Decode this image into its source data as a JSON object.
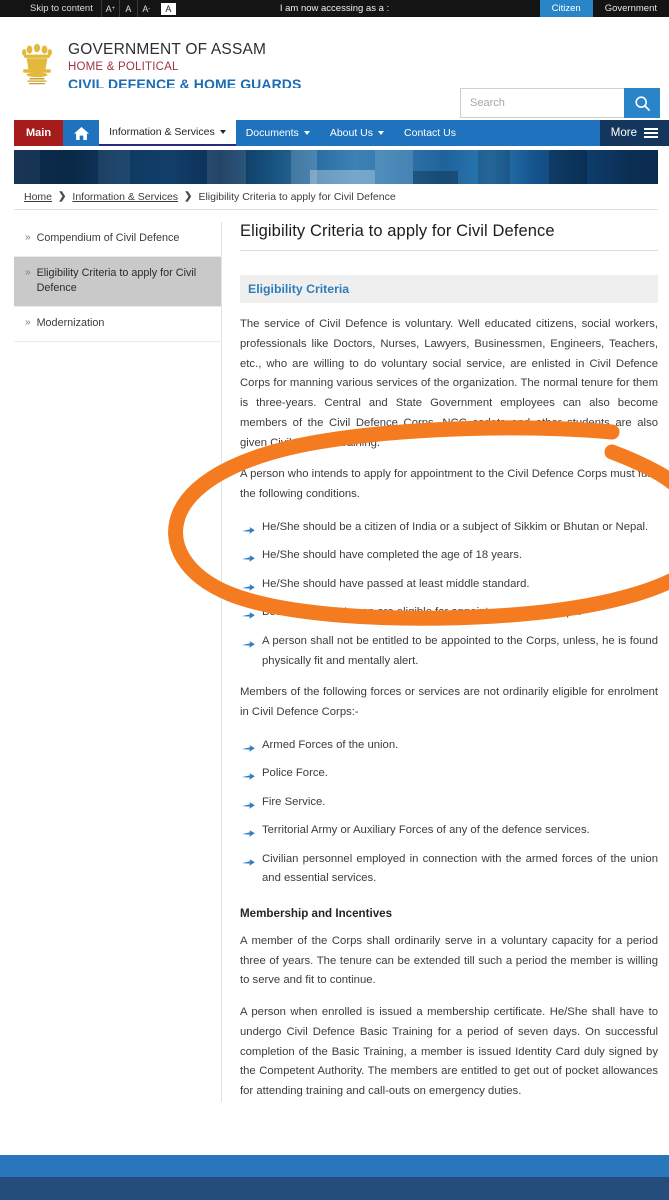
{
  "topbar": {
    "skip_label": "Skip to content",
    "font_increase": "A",
    "font_normal": "A",
    "font_decrease": "A",
    "contrast_toggle": "A",
    "accessing_as_label": "I am now accessing as a :",
    "tabs": [
      {
        "label": "Citizen",
        "active": true
      },
      {
        "label": "Government",
        "active": false
      }
    ]
  },
  "masthead": {
    "emblem_name": "ashoka-emblem",
    "line1": "GOVERNMENT OF ASSAM",
    "line2": "HOME & POLITICAL",
    "line3": "CIVIL DEFENCE & HOME GUARDS"
  },
  "search": {
    "placeholder": "Search",
    "value": "",
    "icon": "search-icon"
  },
  "nav": {
    "main_label": "Main",
    "home_icon": "home-icon",
    "items": [
      {
        "label": "Information & Services",
        "has_caret": true,
        "active": true
      },
      {
        "label": "Documents",
        "has_caret": true,
        "active": false
      },
      {
        "label": "About Us",
        "has_caret": true,
        "active": false
      },
      {
        "label": "Contact Us",
        "has_caret": false,
        "active": false
      }
    ],
    "more_label": "More",
    "more_icon": "hamburger-icon"
  },
  "breadcrumb": {
    "items": [
      {
        "label": "Home",
        "link": true
      },
      {
        "label": "Information & Services",
        "link": true
      },
      {
        "label": "Eligibility Criteria to apply for Civil Defence",
        "link": false
      }
    ],
    "separator": "❯"
  },
  "sidebar": {
    "items": [
      {
        "label": "Compendium of Civil Defence",
        "active": false
      },
      {
        "label": "Eligibility Criteria to apply for Civil Defence",
        "active": true
      },
      {
        "label": "Modernization",
        "active": false
      }
    ],
    "chevron": "»"
  },
  "main": {
    "page_title": "Eligibility Criteria to apply for Civil Defence",
    "sub_heading": "Eligibility Criteria",
    "intro_paragraph": "The service of Civil Defence is voluntary. Well educated citizens, social workers, professionals like Doctors, Nurses, Lawyers, Businessmen, Engineers, Teachers, etc., who are willing to do voluntary social service, are enlisted in Civil Defence Corps for manning various services of the organization. The normal tenure for them is three-years. Central and State Government employees can also become members of the Civil Defence Corps. NCC cadets and other students are also given Civil Defence training.",
    "conditions_lead": " A person who intends to apply for appointment to the Civil Defence Corps must fulfil the following conditions.",
    "conditions": [
      "He/She should be a citizen of India or a subject of Sikkim or Bhutan or Nepal.",
      "He/She should have completed the age of 18 years.",
      "He/She should have passed at least middle standard.",
      "Both Men and Women are eligible for appointment to the Corps.",
      "A person shall not be entitled to be appointed to the Corps, unless, he is found physically fit and mentally alert."
    ],
    "ineligible_lead": "Members of the following forces or services are not ordinarily eligible for enrolment in Civil Defence Corps:-",
    "ineligible": [
      "Armed Forces of the union.",
      "Police Force.",
      "Fire Service.",
      "Territorial Army or Auxiliary Forces of any of the defence services.",
      "Civilian personnel employed in connection with the armed forces of the union and essential services."
    ],
    "membership_heading": "Membership and Incentives",
    "membership_p1": "A member of the Corps shall ordinarily serve in a voluntary capacity for a period three of years. The tenure can be extended till such a period the member is willing to serve and fit to continue.",
    "membership_p2": "A person when enrolled is issued a membership certificate. He/She shall have to undergo Civil Defence Basic Training for a period of seven days. On successful completion of the Basic Training, a member is issued Identity Card duly signed by the Competent Authority. The members are entitled to get out of pocket allowances for attending training and call-outs on emergency duties."
  },
  "annotation": {
    "name": "orange-highlight-ellipse",
    "color": "#F47B20"
  },
  "colors": {
    "topbar_bg": "#141414",
    "accent_blue": "#2a84c8",
    "nav_blue": "#1f72bd",
    "main_red": "#a61c1c",
    "more_navy": "#15365c",
    "brand_maroon": "#9d3440",
    "brand_blue": "#1b6cb5",
    "footer_light": "#2a76bd",
    "footer_dark": "#254d7c",
    "annotation_orange": "#F47B20"
  }
}
